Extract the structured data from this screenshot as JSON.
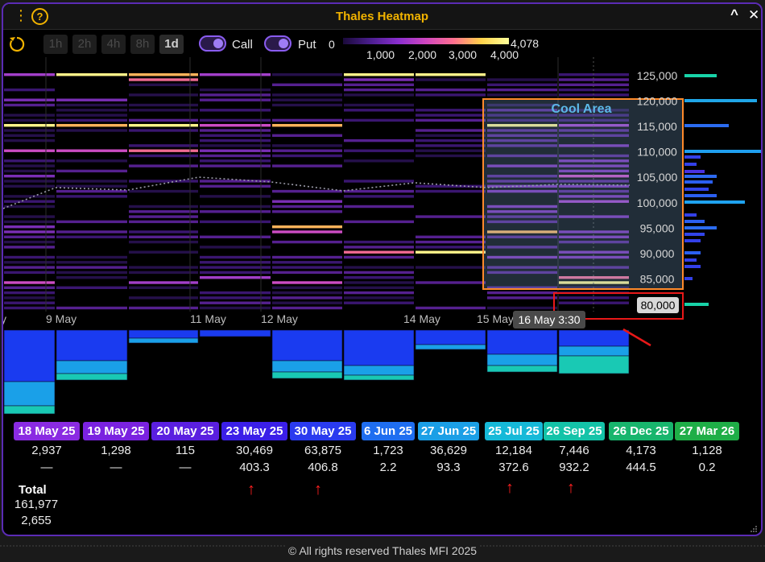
{
  "window": {
    "title": "Thales Heatmap"
  },
  "toolbar": {
    "timeframes": [
      "1h",
      "2h",
      "4h",
      "8h",
      "1d"
    ],
    "active_timeframe": "1d",
    "call_label": "Call",
    "put_label": "Put",
    "legend": {
      "min": "0",
      "max": "4,078",
      "ticks": [
        "1,000",
        "2,000",
        "3,000",
        "4,000"
      ]
    }
  },
  "chart_data": {
    "type": "heatmap",
    "title": "Thales Heatmap",
    "y_ticks": [
      "125,000",
      "120,000",
      "115,000",
      "110,000",
      "105,000",
      "100,000",
      "95,000",
      "90,000",
      "85,000",
      "80,000"
    ],
    "y_values": [
      125000,
      120000,
      115000,
      110000,
      105000,
      100000,
      95000,
      90000,
      85000,
      80000
    ],
    "x_ticks": [
      "y",
      "9 May",
      "11 May",
      "12 May",
      "14 May",
      "15 May"
    ],
    "crosshair_label": "16 May 3:30",
    "highlight_price_label": "80,000",
    "annotation": "Cool Area",
    "color_range": [
      0,
      4078
    ]
  },
  "expiries": [
    {
      "date": "18 May 25",
      "color": "#8a2be2",
      "oi": "2,937",
      "pain": "—"
    },
    {
      "date": "19 May 25",
      "color": "#7a22e0",
      "oi": "1,298",
      "pain": "—"
    },
    {
      "date": "20 May 25",
      "color": "#5a1fe0",
      "oi": "115",
      "pain": "—"
    },
    {
      "date": "23 May 25",
      "color": "#3b1fe8",
      "oi": "30,469",
      "pain": "403.3"
    },
    {
      "date": "30 May 25",
      "color": "#2a3bef",
      "oi": "63,875",
      "pain": "406.8"
    },
    {
      "date": "6 Jun 25",
      "color": "#1f6ef0",
      "oi": "1,723",
      "pain": "2.2"
    },
    {
      "date": "27 Jun 25",
      "color": "#1b9fe6",
      "oi": "36,629",
      "pain": "93.3"
    },
    {
      "date": "25 Jul 25",
      "color": "#16b9d8",
      "oi": "12,184",
      "pain": "372.6"
    },
    {
      "date": "26 Sep 25",
      "color": "#14c3a8",
      "oi": "7,446",
      "pain": "932.2"
    },
    {
      "date": "26 Dec 25",
      "color": "#18b56d",
      "oi": "4,173",
      "pain": "444.5"
    },
    {
      "date": "27 Mar 26",
      "color": "#1fae47",
      "oi": "1,128",
      "pain": "0.2"
    }
  ],
  "totals": {
    "label": "Total",
    "oi": "161,977",
    "pain": "2,655"
  },
  "footer": {
    "text": "© All rights reserved Thales MFI 2025"
  }
}
